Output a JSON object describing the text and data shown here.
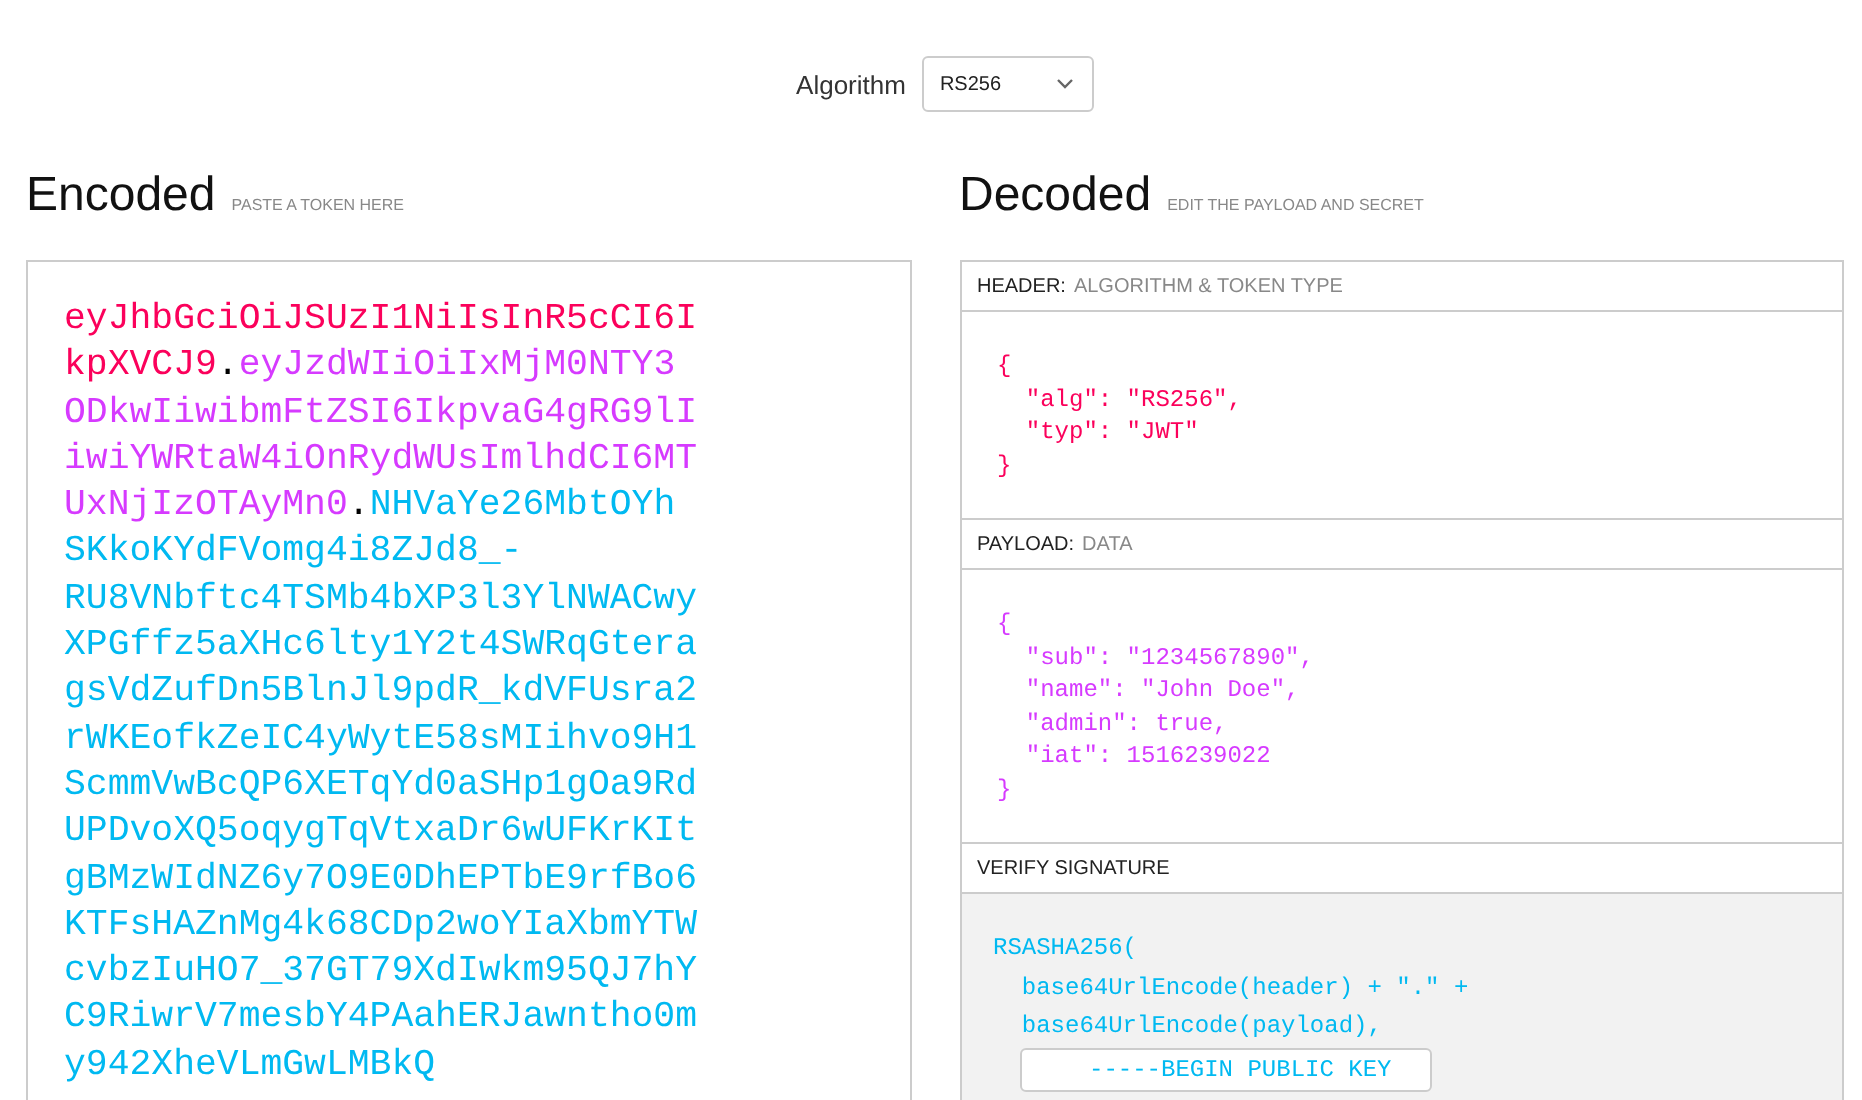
{
  "algorithm": {
    "label": "Algorithm",
    "value": "RS256"
  },
  "encoded": {
    "title": "Encoded",
    "subtitle": "PASTE A TOKEN HERE",
    "parts": [
      {
        "text": "eyJhbGciOiJSUzI1NiIsInR5cCI6IkpXVCJ9",
        "color": "#fb015b"
      },
      {
        "text": ".",
        "color": "#000000"
      },
      {
        "text": "eyJzdWIiOiIxMjM0NTY3ODkwIiwibmFtZSI6IkpvaG4gRG9lIiwiYWRtaW4iOnRydWUsImlhdCI6MTUxNjIzOTAyMn0",
        "color": "#d63aff"
      },
      {
        "text": ".",
        "color": "#000000"
      },
      {
        "text": "NHVaYe26MbtOYhSKkoKYdFVomg4i8ZJd8_-RU8VNbftc4TSMb4bXP3l3YlNWACwyXPGffz5aXHc6lty1Y2t4SWRqGteragsVdZufDn5BlnJl9pdR_kdVFUsra2rWKEofkZeIC4yWytE58sMIihvo9H1ScmmVwBcQP6XETqYd0aSHp1gOa9RdUPDvoXQ5oqygTqVtxaDr6wUFKrKItgBMzWIdNZ6y7O9E0DhEPTbE9rfBo6KTFsHAZnMg4k68CDp2woYIaXbmYTWcvbzIuHO7_37GT79XdIwkm95QJ7hYC9RiwrV7mesbY4PAahERJawntho0my942XheVLmGwLMBkQ",
        "color": "#00b9f1"
      }
    ]
  },
  "decoded": {
    "title": "Decoded",
    "subtitle": "EDIT THE PAYLOAD AND SECRET",
    "sections": [
      {
        "kind": "json",
        "title": "HEADER:",
        "subtitle": "ALGORITHM & TOKEN TYPE",
        "color": "#fb015b",
        "lines": [
          "{",
          "  \"alg\": \"RS256\",",
          "  \"typ\": \"JWT\"",
          "}"
        ]
      },
      {
        "kind": "json",
        "title": "PAYLOAD:",
        "subtitle": "DATA",
        "color": "#d63aff",
        "lines": [
          "{",
          "  \"sub\": \"1234567890\",",
          "  \"name\": \"John Doe\",",
          "  \"admin\": true,",
          "  \"iat\": 1516239022",
          "}"
        ]
      },
      {
        "kind": "signature",
        "title": "VERIFY SIGNATURE",
        "color": "#00b9f1",
        "lines": [
          "RSASHA256(",
          "  base64UrlEncode(header) + \".\" +",
          "  base64UrlEncode(payload),"
        ],
        "key": "-----BEGIN PUBLIC KEY"
      }
    ]
  }
}
